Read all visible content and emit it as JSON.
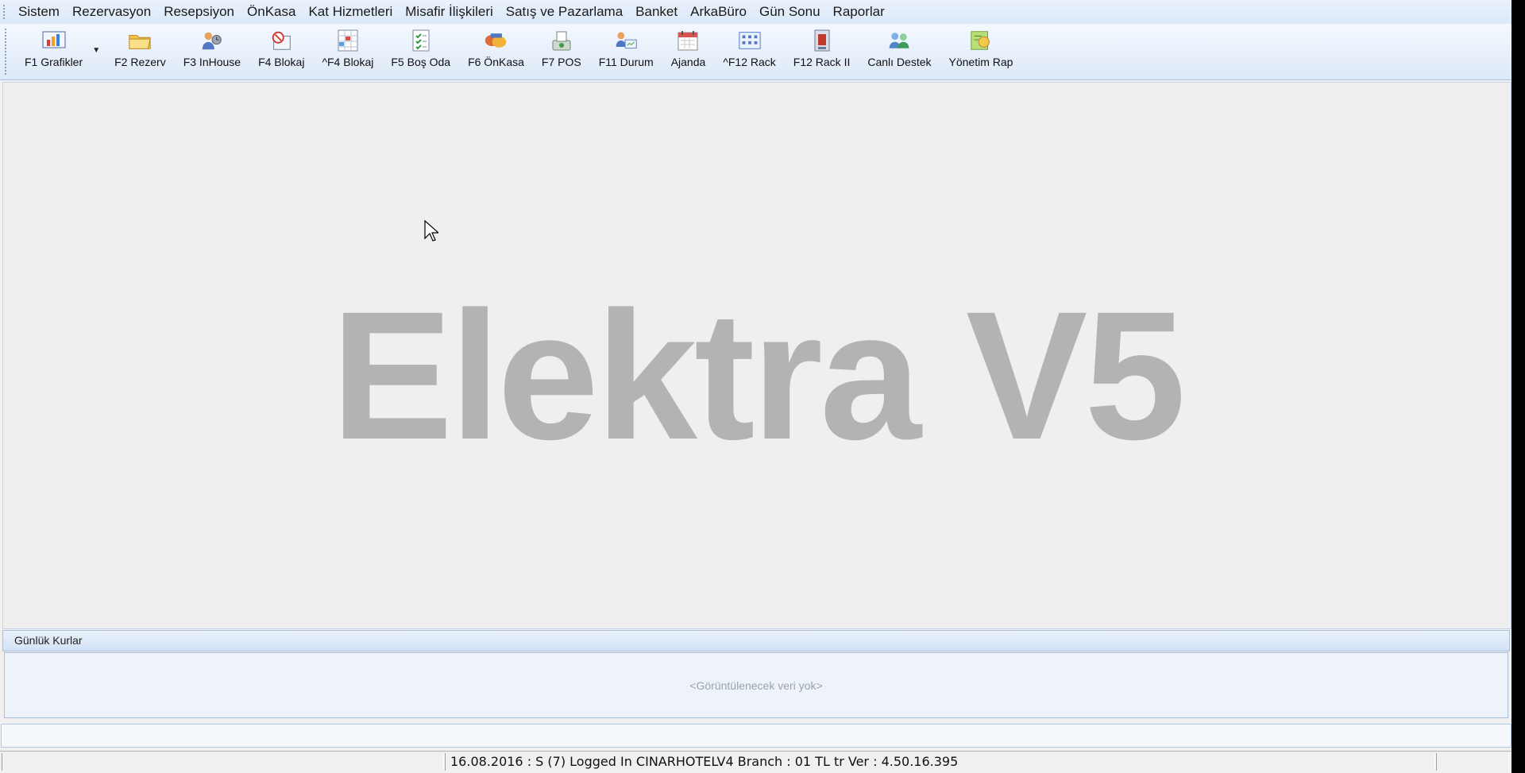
{
  "menu": {
    "items": [
      "Sistem",
      "Rezervasyon",
      "Resepsiyon",
      "ÖnKasa",
      "Kat Hizmetleri",
      "Misafir İlişkileri",
      "Satış ve Pazarlama",
      "Banket",
      "ArkaBüro",
      "Gün Sonu",
      "Raporlar"
    ]
  },
  "toolbar": {
    "buttons": [
      {
        "label": "F1 Grafikler",
        "icon": "chart-icon"
      },
      {
        "label": "F2 Rezerv",
        "icon": "folder-icon"
      },
      {
        "label": "F3 InHouse",
        "icon": "guests-icon"
      },
      {
        "label": "F4 Blokaj",
        "icon": "block-icon"
      },
      {
        "label": "^F4 Blokaj",
        "icon": "grid-block-icon"
      },
      {
        "label": "F5 Boş Oda",
        "icon": "checklist-icon"
      },
      {
        "label": "F6 ÖnKasa",
        "icon": "cashier-icon"
      },
      {
        "label": "F7 POS",
        "icon": "pos-icon"
      },
      {
        "label": "F11 Durum",
        "icon": "status-icon"
      },
      {
        "label": "Ajanda",
        "icon": "calendar-icon"
      },
      {
        "label": "^F12 Rack",
        "icon": "rack-icon"
      },
      {
        "label": "F12 Rack II",
        "icon": "rack2-icon"
      },
      {
        "label": "Canlı Destek",
        "icon": "support-icon"
      },
      {
        "label": "Yönetim Rap",
        "icon": "report-icon"
      }
    ]
  },
  "workspace": {
    "watermark": "Elektra V5"
  },
  "rates_panel": {
    "title": "Günlük Kurlar",
    "empty_text": "<Görüntülenecek veri yok>"
  },
  "statusbar": {
    "text": "16.08.2016 : S (7) Logged In CINARHOTELV4 Branch : 01  TL tr Ver : 4.50.16.395"
  },
  "colors": {
    "menubar_bg": "#dbe8f8",
    "watermark": "#b3b3b3",
    "panel_border": "#a9bfdb"
  }
}
